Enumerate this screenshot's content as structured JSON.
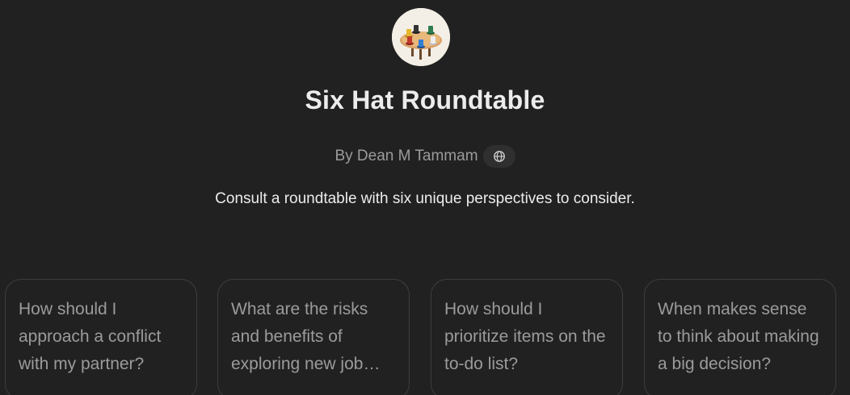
{
  "gpt": {
    "title": "Six Hat Roundtable",
    "author": "By Dean M Tammam",
    "description": "Consult a roundtable with six unique perspectives to consider."
  },
  "icons": {
    "avatar": "roundtable-hats-image",
    "author_badge": "globe-icon"
  },
  "conversation_starters": [
    {
      "text": "How should I approach a conflict with my partner?"
    },
    {
      "text": "What are the risks and benefits of exploring new job opportunities?"
    },
    {
      "text": "How should I prioritize items on the to-do list?"
    },
    {
      "text": "When makes sense to think about making a big decision?"
    }
  ],
  "colors": {
    "background": "#212121",
    "text_primary": "#ececec",
    "text_secondary": "#9b9b9b",
    "card_border": "#3d3d3d"
  }
}
